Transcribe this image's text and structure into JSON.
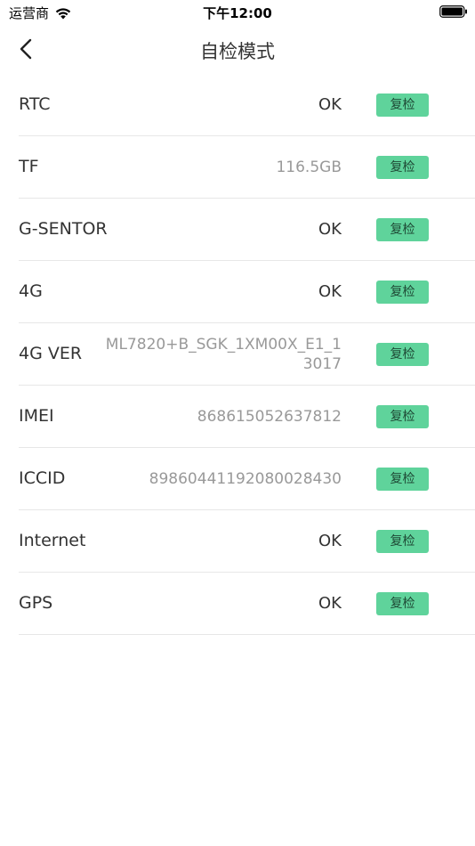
{
  "status_bar": {
    "carrier": "运营商",
    "time": "下午12:00"
  },
  "nav": {
    "title": "自检模式"
  },
  "accent_color": "#5fd39b",
  "rows": [
    {
      "label": "RTC",
      "value": "OK",
      "button": "复检"
    },
    {
      "label": "TF",
      "value": "116.5GB",
      "button": "复检"
    },
    {
      "label": "G-SENTOR",
      "value": "OK",
      "button": "复检"
    },
    {
      "label": "4G",
      "value": "OK",
      "button": "复检"
    },
    {
      "label": "4G VER",
      "value": "ML7820+B_SGK_1XM00X_E1_13017",
      "button": "复检"
    },
    {
      "label": "IMEI",
      "value": "868615052637812",
      "button": "复检"
    },
    {
      "label": "ICCID",
      "value": "89860441192080028430",
      "button": "复检"
    },
    {
      "label": "Internet",
      "value": "OK",
      "button": "复检"
    },
    {
      "label": "GPS",
      "value": "OK",
      "button": "复检"
    }
  ]
}
